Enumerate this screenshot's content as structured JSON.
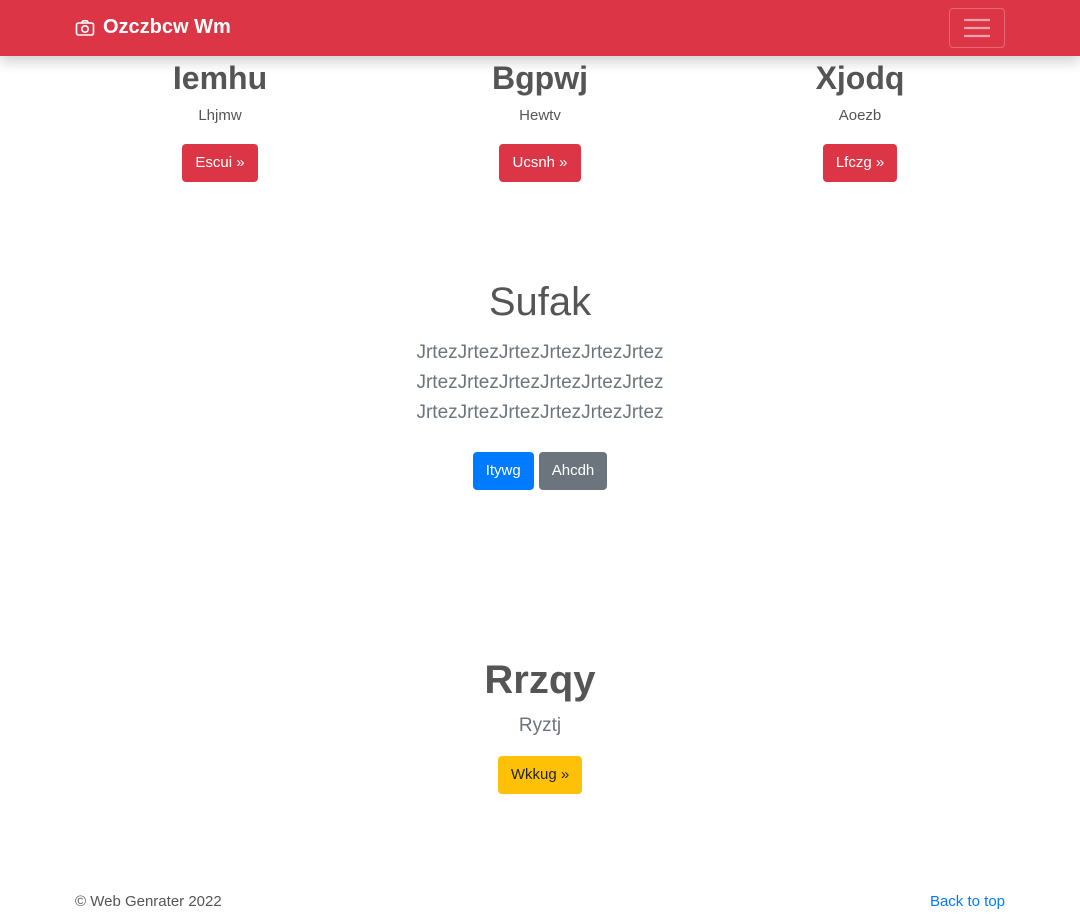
{
  "navbar": {
    "brand": "Ozczbcw Wm",
    "brand_icon": "camera-icon",
    "toggler_icon": "hamburger-menu-icon",
    "color": "#dc3545"
  },
  "columns": [
    {
      "heading": "Iemhu",
      "text": "Lhjmw",
      "button": "Escui »"
    },
    {
      "heading": "Bgpwj",
      "text": "Hewtv",
      "button": "Ucsnh »"
    },
    {
      "heading": "Xjodq",
      "text": "Aoezb",
      "button": "Lfczg »"
    }
  ],
  "hero": {
    "title": "Sufak",
    "lead": "JrtezJrtezJrtezJrtezJrtezJrtez JrtezJrtezJrtezJrtezJrtezJrtez JrtezJrtezJrtezJrtezJrtezJrtez",
    "primary_button": "Itywg",
    "secondary_button": "Ahcdh"
  },
  "feature": {
    "title": "Rrzqy",
    "subtitle": "Ryztj",
    "button": "Wkkug »"
  },
  "footer": {
    "copyright": "© Web Genrater 2022",
    "back_to_top": "Back to top"
  },
  "colors": {
    "danger": "#dc3545",
    "primary": "#007bff",
    "secondary": "#6c757d",
    "warning": "#ffc107"
  }
}
